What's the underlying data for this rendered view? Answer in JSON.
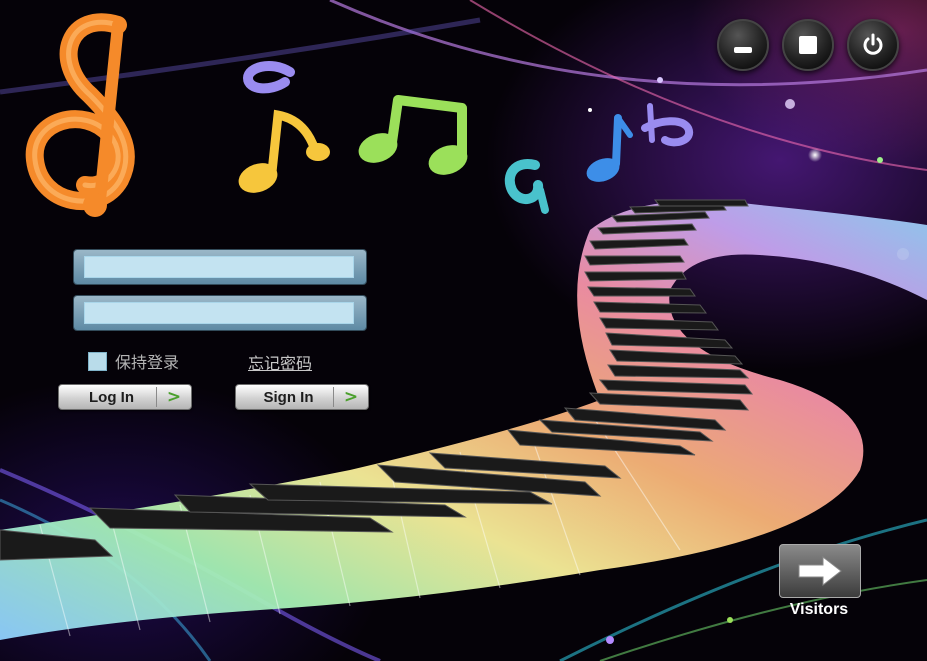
{
  "window_controls": {
    "minimize_icon": "minimize-icon",
    "maximize_icon": "maximize-icon",
    "power_icon": "power-icon"
  },
  "login": {
    "username_value": "",
    "password_value": "",
    "remember_label": "保持登录",
    "forgot_label": "忘记密码",
    "login_label": "Log In",
    "signin_label": "Sign In",
    "arrow": ">"
  },
  "visitors": {
    "label": "Visitors",
    "icon": "arrow-right-icon"
  },
  "colors": {
    "note_orange": "#f58a2a",
    "note_yellow": "#f6c63c",
    "note_green": "#9be05a",
    "note_teal": "#49c2cc",
    "note_blue": "#3d8ee8",
    "note_violet": "#9a8cf0",
    "button_arrow": "#4aa02c",
    "field_fill": "#c3e3f1"
  }
}
